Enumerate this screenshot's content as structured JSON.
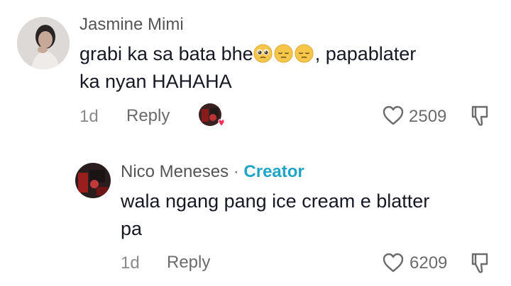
{
  "comments": [
    {
      "username": "Jasmine Mimi",
      "text_part1": "grabi ka sa bata bhe",
      "emojis": [
        "pleading-face-emoji",
        "pensive-face-emoji",
        "pensive-face-emoji"
      ],
      "text_part2": ", papablater",
      "text_line2": "ka nyan HAHAHA",
      "time": "1d",
      "reply_label": "Reply",
      "like_count": "2509"
    },
    {
      "username": "Nico Meneses",
      "separator": "·",
      "badge": "Creator",
      "text_line1": "wala ngang pang ice cream e blatter",
      "text_line2": "pa",
      "time": "1d",
      "reply_label": "Reply",
      "like_count": "6209"
    }
  ]
}
